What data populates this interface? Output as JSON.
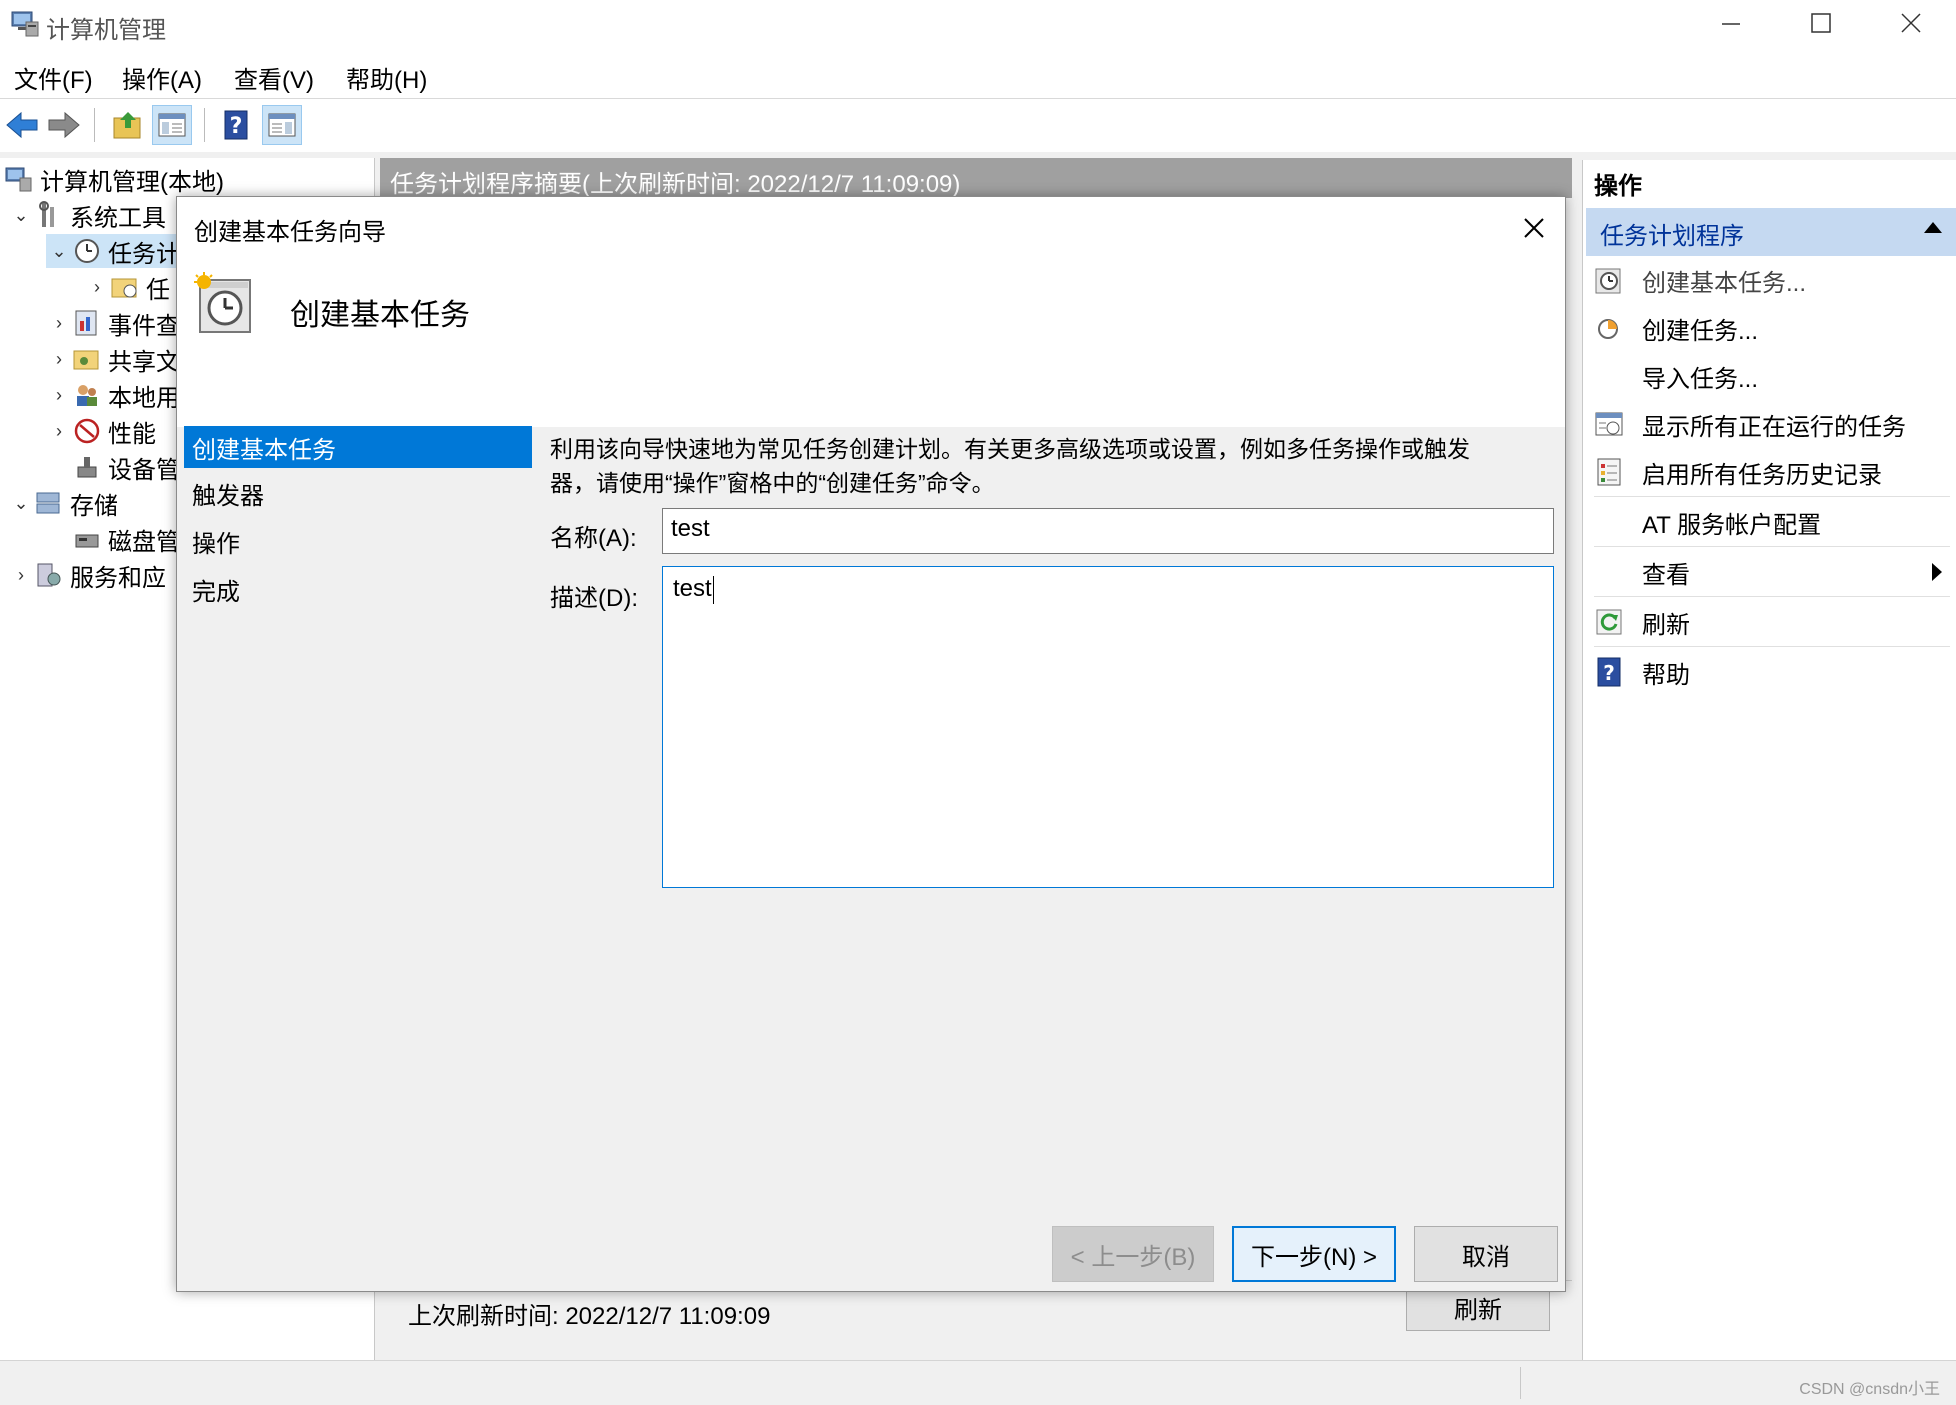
{
  "window": {
    "title": "计算机管理",
    "minimize": "—",
    "maximize": "☐",
    "close": "✕"
  },
  "menu": [
    "文件(F)",
    "操作(A)",
    "查看(V)",
    "帮助(H)"
  ],
  "tree": {
    "root": "计算机管理(本地)",
    "system_tools": "系统工具",
    "task_scheduler": "任务计",
    "task_lib": "任",
    "event_viewer": "事件查",
    "shared": "共享文",
    "local_users": "本地用",
    "performance": "性能",
    "device_mgr": "设备管",
    "storage": "存储",
    "disk_mgmt": "磁盘管",
    "services": "服务和应"
  },
  "center": {
    "header": "任务计划程序摘要(上次刷新时间: 2022/12/7 11:09:09)",
    "footer_time": "上次刷新时间: 2022/12/7 11:09:09",
    "refresh_button": "刷新"
  },
  "actions": {
    "title": "操作",
    "section": "任务计划程序",
    "items": [
      {
        "label": "创建基本任务...",
        "icon": "create-basic-task-icon"
      },
      {
        "label": "创建任务...",
        "icon": "create-task-icon"
      },
      {
        "label": "导入任务...",
        "icon": ""
      },
      {
        "label": "显示所有正在运行的任务",
        "icon": "running-tasks-icon"
      },
      {
        "label": "启用所有任务历史记录",
        "icon": "task-history-icon"
      },
      {
        "label": "AT 服务帐户配置",
        "icon": ""
      },
      {
        "label": "查看",
        "icon": ""
      },
      {
        "label": "刷新",
        "icon": "refresh-icon"
      },
      {
        "label": "帮助",
        "icon": "help-icon"
      }
    ]
  },
  "dialog": {
    "title": "创建基本任务向导",
    "close": "✕",
    "heading": "创建基本任务",
    "steps": [
      "创建基本任务",
      "触发器",
      "操作",
      "完成"
    ],
    "description_line1": "利用该向导快速地为常见任务创建计划。有关更多高级选项或设置，例如多任务操作或触发",
    "description_line2": "器，请使用“操作”窗格中的“创建任务”命令。",
    "name_label": "名称(A):",
    "name_value": "test",
    "desc_label": "描述(D):",
    "desc_value": "test",
    "back_button": "< 上一步(B)",
    "next_button": "下一步(N) >",
    "cancel_button": "取消"
  },
  "status": {
    "watermark": "CSDN @cnsdn小王"
  },
  "colors": {
    "selection_blue": "#0078d7",
    "section_header": "#c5d9f1",
    "summary_header": "#a0a0a0"
  }
}
